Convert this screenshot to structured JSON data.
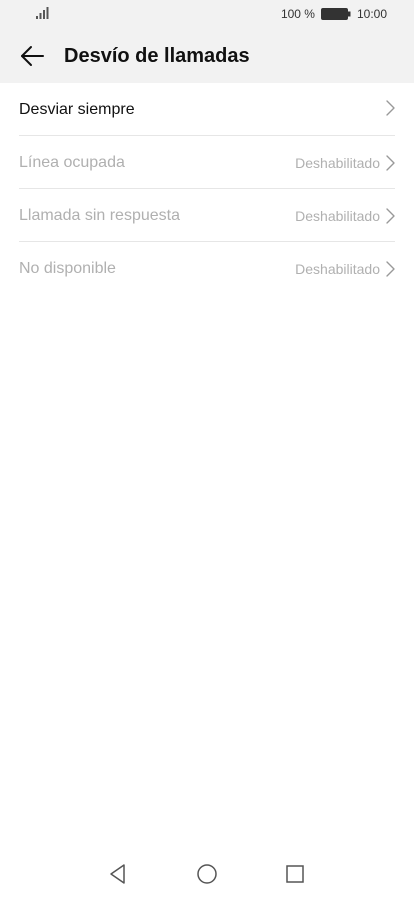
{
  "status_bar": {
    "battery_text": "100 %",
    "time": "10:00"
  },
  "header": {
    "title": "Desvío de llamadas"
  },
  "settings": [
    {
      "label": "Desviar siempre",
      "value": "",
      "enabled": true
    },
    {
      "label": "Línea ocupada",
      "value": "Deshabilitado",
      "enabled": false
    },
    {
      "label": "Llamada sin respuesta",
      "value": "Deshabilitado",
      "enabled": false
    },
    {
      "label": "No disponible",
      "value": "Deshabilitado",
      "enabled": false
    }
  ],
  "icons": {
    "back": "arrow-left-icon",
    "chevron": "chevron-right-icon",
    "nav_back": "triangle-back-icon",
    "nav_home": "circle-home-icon",
    "nav_recent": "square-recent-icon"
  },
  "colors": {
    "header_bg": "#f2f2f2",
    "text_primary": "#111111",
    "text_disabled": "#b0b0b0",
    "divider": "#e6e6e6"
  }
}
